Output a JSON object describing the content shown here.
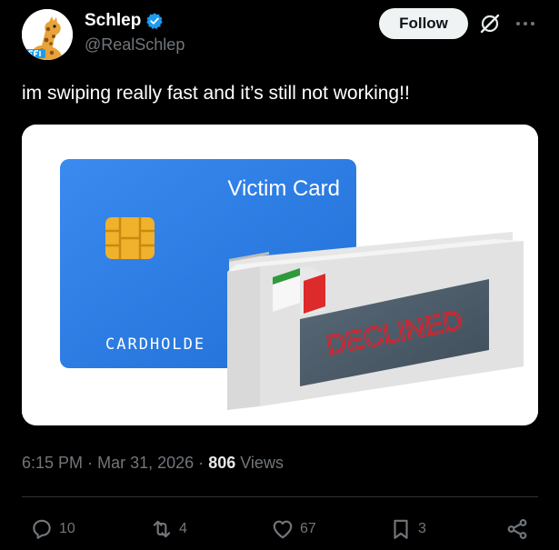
{
  "post": {
    "author": {
      "display_name": "Schlep",
      "handle": "@RealSchlep",
      "verified": true,
      "avatar_icon": "giraffe-avatar"
    },
    "follow_label": "Follow",
    "text": "im swiping really fast and it’s still not working!!",
    "media": {
      "card_label": "Victim Card",
      "cardholder_text": "CARDHOLDE",
      "reader_display": "DECLINED"
    },
    "meta": {
      "time": "6:15 PM",
      "separator": "·",
      "date": "Mar 31, 2026",
      "views_count": "806",
      "views_label": "Views"
    },
    "actions": {
      "replies": "10",
      "reposts": "4",
      "likes": "67",
      "bookmarks": "3"
    }
  },
  "colors": {
    "background": "#000000",
    "verified": "#1d9bf0",
    "muted": "#71767b",
    "card_blue": "#2d7fe3",
    "declined_red": "#e0202a"
  }
}
